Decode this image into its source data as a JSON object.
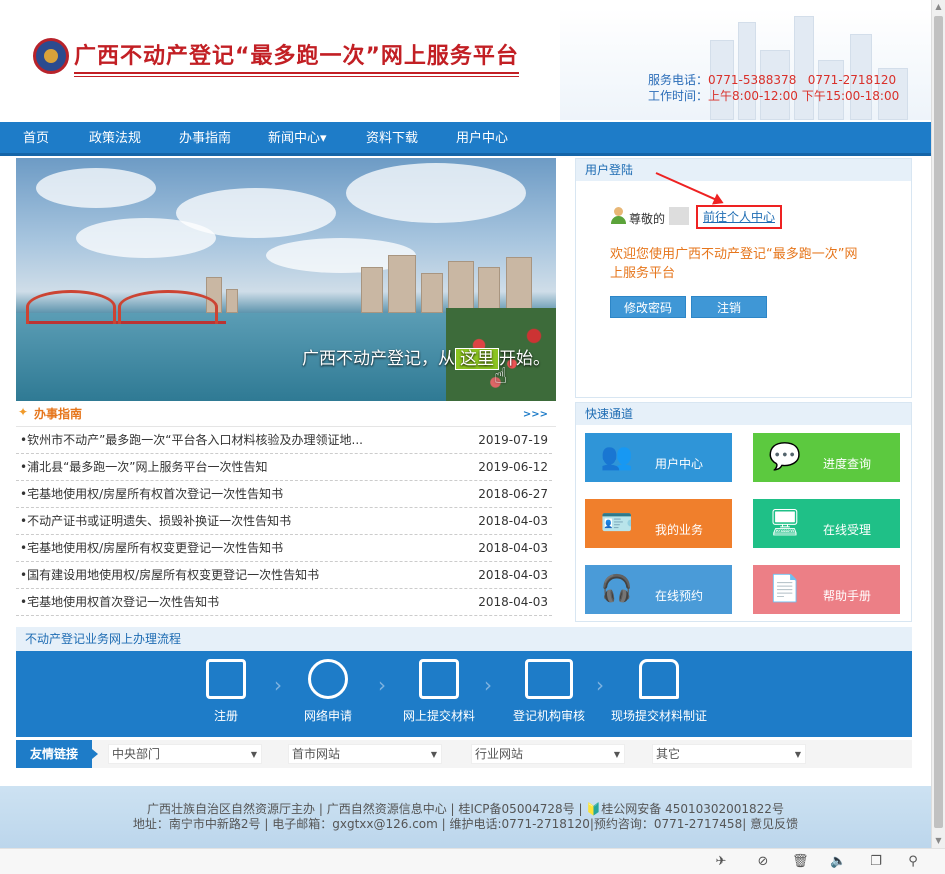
{
  "header": {
    "title": "广西不动产登记“最多跑一次”网上服务平台",
    "service_phone_label": "服务电话：",
    "service_phone_1": "0771-5388378",
    "service_phone_2": "0771-2718120",
    "work_time_label": "工作时间：",
    "work_time_am": "上午8:00-12:00",
    "work_time_pm": "下午15:00-18:00"
  },
  "nav": {
    "items": [
      "首页",
      "政策法规",
      "办事指南",
      "新闻中心▾",
      "资料下载",
      "用户中心"
    ]
  },
  "banner": {
    "slogan_pre": "广西不动产登记，从",
    "slogan_highlight": "这里",
    "slogan_post": "开始。"
  },
  "guide": {
    "title": "办事指南",
    "more": ">>>",
    "rows": [
      {
        "title": "钦州市不动产”最多跑一次“平台各入口材料核验及办理领证地...",
        "date": "2019-07-19"
      },
      {
        "title": "浦北县“最多跑一次”网上服务平台一次性告知",
        "date": "2019-06-12"
      },
      {
        "title": "宅基地使用权/房屋所有权首次登记一次性告知书",
        "date": "2018-06-27"
      },
      {
        "title": "不动产证书或证明遗失、损毁补换证一次性告知书",
        "date": "2018-04-03"
      },
      {
        "title": "宅基地使用权/房屋所有权变更登记一次性告知书",
        "date": "2018-04-03"
      },
      {
        "title": "国有建设用地使用权/房屋所有权变更登记一次性告知书",
        "date": "2018-04-03"
      },
      {
        "title": "宅基地使用权首次登记一次性告知书",
        "date": "2018-04-03"
      }
    ]
  },
  "login": {
    "title": "用户登陆",
    "greeting": "尊敬的",
    "center_link": "前往个人中心",
    "welcome": "欢迎您使用广西不动产登记“最多跑一次”网上服务平台",
    "change_password": "修改密码",
    "logout": "注销"
  },
  "quick": {
    "title": "快速通道",
    "tiles": [
      {
        "label": "用户中心",
        "color": "#2f95d8",
        "icon": "users-icon"
      },
      {
        "label": "进度查询",
        "color": "#5cc93f",
        "icon": "chat-search-icon"
      },
      {
        "label": "我的业务",
        "color": "#f07f2c",
        "icon": "id-card-icon"
      },
      {
        "label": "在线受理",
        "color": "#1fc087",
        "icon": "monitor-icon"
      },
      {
        "label": "在线预约",
        "color": "#4a9bd8",
        "icon": "headset-icon"
      },
      {
        "label": "帮助手册",
        "color": "#ec7f86",
        "icon": "help-doc-icon"
      }
    ]
  },
  "flow": {
    "title": "不动产登记业务网上办理流程",
    "steps": [
      "注册",
      "网络申请",
      "网上提交材料",
      "登记机构审核",
      "现场提交材料制证"
    ]
  },
  "links": {
    "label": "友情链接",
    "selects": [
      "中央部门",
      "首市网站",
      "行业网站",
      "其它"
    ]
  },
  "footer": {
    "line1": "广西壮族自治区自然资源厅主办 | 广西自然资源信息中心 | 桂ICP备05004728号 | 🔰桂公网安备 45010302001822号",
    "line2": "地址：南宁市中新路2号 | 电子邮箱：gxgtxx@126.com | 维护电话:0771-2718120|预约咨询：0771-2717458| 意见反馈"
  },
  "colors": {
    "brand_blue": "#1e7cc8",
    "title_red": "#c21f24",
    "accent_orange": "#e6761c"
  }
}
